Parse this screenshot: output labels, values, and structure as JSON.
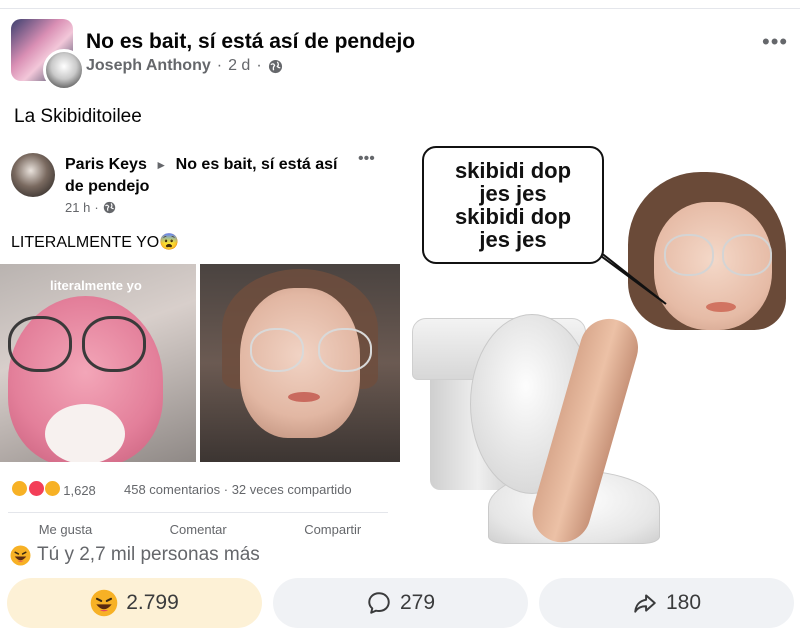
{
  "post": {
    "group_name": "No es bait, sí está así de pendejo",
    "author": "Joseph Anthony",
    "separator": "·",
    "time": "2 d",
    "privacy_icon": "globe-icon",
    "more_icon": "•••",
    "text": "La Skibiditoilee"
  },
  "meme": {
    "left": {
      "inner_post": {
        "author": "Paris Keys",
        "arrow": "►",
        "group": "No es bait, sí está así de pendejo",
        "more": "•••",
        "time": "21 h",
        "separator": "·",
        "text": "LITERALMENTE YO😨",
        "photo_caption": "literalmente yo",
        "reaction_count": "1,628",
        "comments": "458 comentarios",
        "shares": "32 veces compartido",
        "actions": [
          "Me gusta",
          "Comentar",
          "Compartir"
        ]
      }
    },
    "right": {
      "bubble_lines": [
        "skibidi dop",
        "jes jes",
        "skibidi dop",
        "jes jes"
      ]
    }
  },
  "reactions": {
    "summary": "Tú y 2,7 mil personas más",
    "react_count": "2.799",
    "comment_count": "279",
    "share_count": "180"
  },
  "colors": {
    "reaction_button_bg": "#fdf1d6",
    "button_bg": "#f0f2f5",
    "secondary_text": "#65676b"
  }
}
